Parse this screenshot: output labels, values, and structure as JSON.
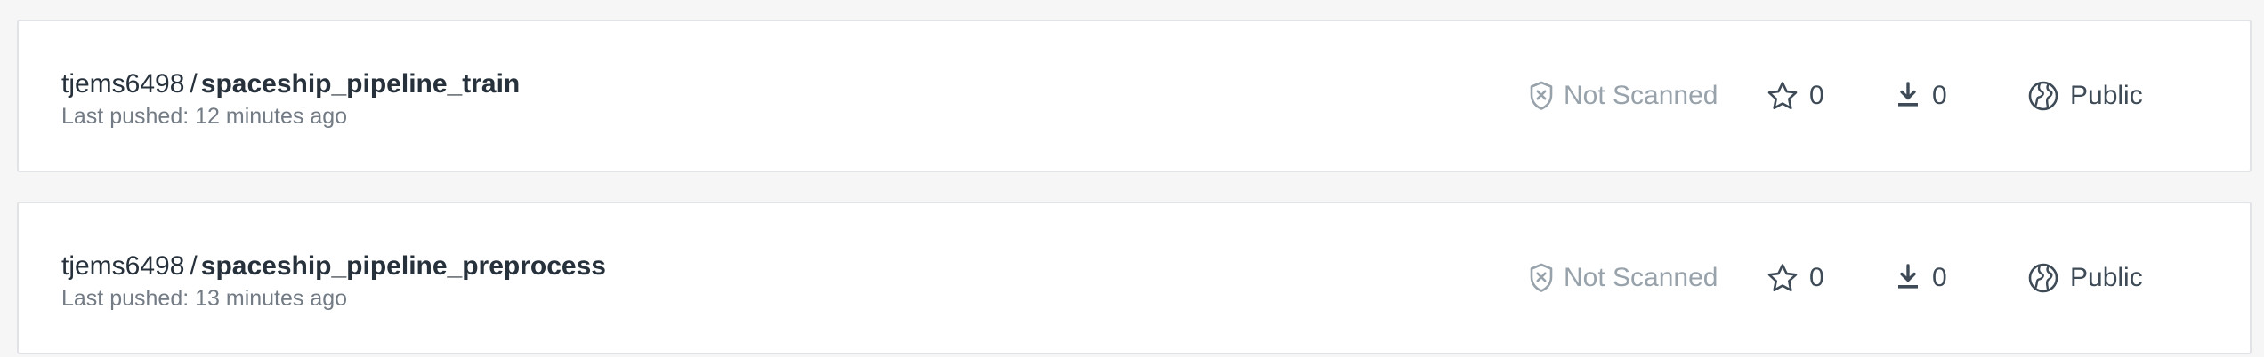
{
  "repositories": [
    {
      "namespace": "tjems6498",
      "separator": "/",
      "name": "spaceship_pipeline_train",
      "last_pushed": "Last pushed: 12 minutes ago",
      "scan_status": "Not Scanned",
      "stars": "0",
      "pulls": "0",
      "visibility": "Public"
    },
    {
      "namespace": "tjems6498",
      "separator": "/",
      "name": "spaceship_pipeline_preprocess",
      "last_pushed": "Last pushed: 13 minutes ago",
      "scan_status": "Not Scanned",
      "stars": "0",
      "pulls": "0",
      "visibility": "Public"
    }
  ],
  "icons": {
    "scan": "shield-x-icon",
    "stars": "star-icon",
    "pulls": "download-icon",
    "visibility": "globe-icon"
  },
  "colors": {
    "background": "#f6f6f6",
    "card": "#ffffff",
    "card_border": "#e1e3e6",
    "text_primary": "#27313b",
    "text_secondary": "#737b85",
    "muted": "#98a2ab",
    "icon": "#3e4b57"
  }
}
